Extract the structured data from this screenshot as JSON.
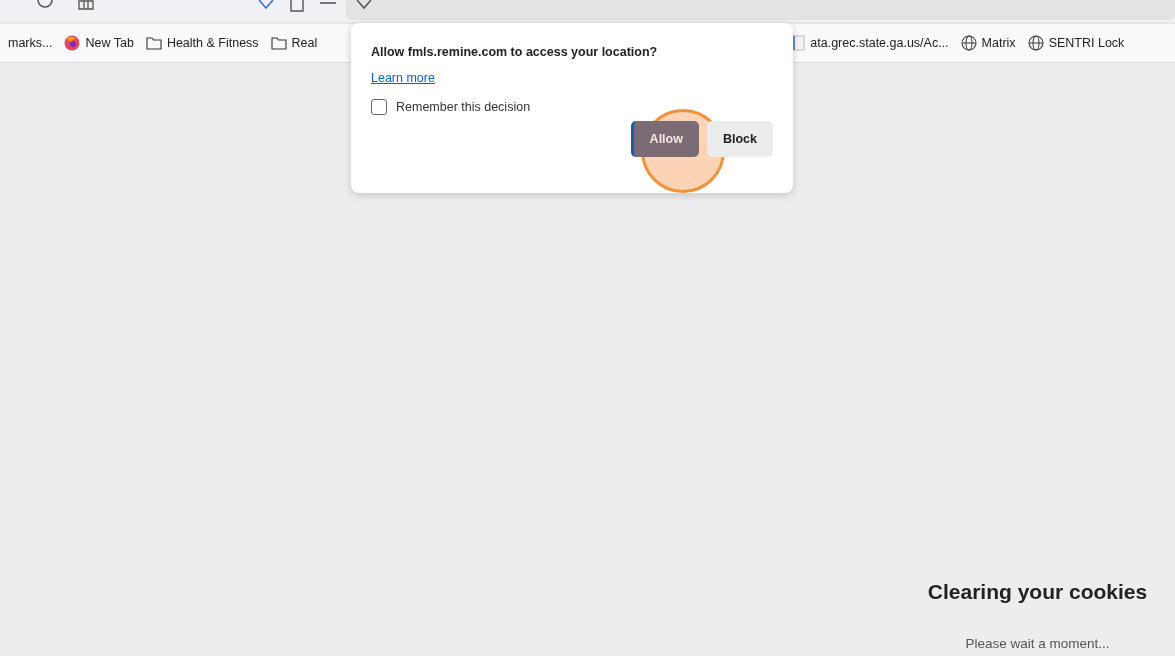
{
  "bookmarks": [
    {
      "kind": "text",
      "label": "marks..."
    },
    {
      "kind": "firefox",
      "label": "New Tab"
    },
    {
      "kind": "folder",
      "label": "Health & Fitness"
    },
    {
      "kind": "folder",
      "label": "Real"
    },
    {
      "kind": "doc",
      "label": "ata.grec.state.ga.us/Ac..."
    },
    {
      "kind": "globe",
      "label": "Matrix"
    },
    {
      "kind": "globe",
      "label": "SENTRI Lock"
    }
  ],
  "permission_popup": {
    "question": "Allow fmls.remine.com to access your location?",
    "link": "Learn more",
    "remember": {
      "label": "Remember this decision",
      "checked": false
    },
    "buttons": [
      {
        "label": "Allow",
        "kind": "primary"
      },
      {
        "label": "Block",
        "kind": "secondary"
      }
    ]
  },
  "page": {
    "heading": "Clearing your cookies",
    "message": "Please wait a moment..."
  }
}
